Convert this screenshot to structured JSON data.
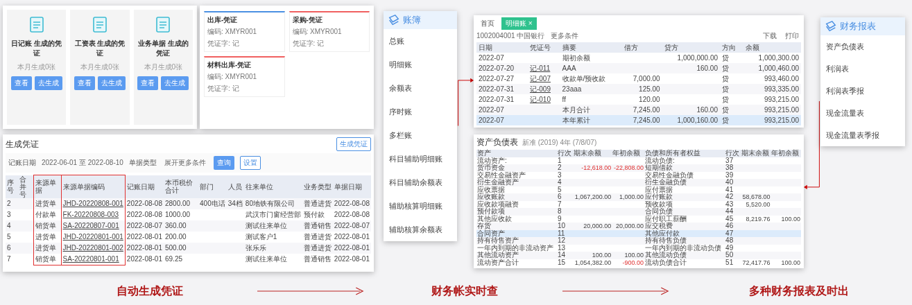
{
  "voucher_gen": {
    "cards": [
      {
        "title": "日记账 生成的凭证",
        "count": "本月生成0张",
        "buttons": [
          "查看",
          "去生成"
        ]
      },
      {
        "title": "工资表 生成的凭证",
        "count": "本月生成0张",
        "buttons": [
          "查看",
          "去生成"
        ]
      },
      {
        "title": "业务单据 生成的凭证",
        "count": "本月生成0张",
        "buttons": [
          "查看",
          "去生成"
        ]
      }
    ],
    "templates": [
      {
        "title": "出库-凭证",
        "code": "编码: XMYR001",
        "word": "凭证字: 记",
        "color": "#4a90e2"
      },
      {
        "title": "采购-凭证",
        "code": "编码: XMYR001",
        "word": "凭证字: 记",
        "color": "#f06060"
      },
      {
        "title": "材料出库-凭证",
        "code": "编码: XMYR001",
        "word": "凭证字: 记",
        "color": "#f06060"
      }
    ],
    "table": {
      "title": "生成凭证",
      "action": "生成凭证",
      "date_label": "记账日期",
      "date_range": "2022-06-01 至 2022-08-10",
      "type_label": "单据类型",
      "query": "查询",
      "settings": "设置",
      "expand": "展开更多条件",
      "columns": [
        {
          "label": "序号",
          "highlighted": false
        },
        {
          "label": "合并号",
          "highlighted": false
        },
        {
          "label": "来源单据",
          "highlighted": true
        },
        {
          "label": "来源单据编码",
          "highlighted": true
        },
        {
          "label": "记账日期",
          "highlighted": false
        },
        {
          "label": "本币税价合计",
          "highlighted": false
        },
        {
          "label": "部门",
          "highlighted": false
        },
        {
          "label": "人员",
          "highlighted": false
        },
        {
          "label": "往来单位",
          "highlighted": false
        },
        {
          "label": "业务类型",
          "highlighted": false
        },
        {
          "label": "单据日期",
          "highlighted": false
        }
      ],
      "rows": [
        [
          "2",
          "",
          "进货单",
          "JHD-20220808-001",
          "2022-08-08",
          "2800.00",
          "400电话",
          "34档",
          "80地铁有限公司",
          "普通进货",
          "2022-08-08"
        ],
        [
          "3",
          "",
          "付款单",
          "FK-20220808-003",
          "2022-08-08",
          "1000.00",
          "",
          "",
          "武汉市门窗经营部",
          "预付款",
          "2022-08-08"
        ],
        [
          "4",
          "",
          "销货单",
          "SA-20220807-001",
          "2022-08-07",
          "360.00",
          "",
          "",
          "测试往来单位",
          "普通销售",
          "2022-08-07"
        ],
        [
          "5",
          "",
          "进货单",
          "JHD-20220801-001",
          "2022-08-01",
          "200.00",
          "",
          "",
          "测试客户1",
          "普通进货",
          "2022-08-01"
        ],
        [
          "6",
          "",
          "进货单",
          "JHD-20220801-002",
          "2022-08-01",
          "500.00",
          "",
          "",
          "张乐乐",
          "普通进货",
          "2022-08-01"
        ],
        [
          "7",
          "",
          "销货单",
          "SA-20220801-001",
          "2022-08-01",
          "69.25",
          "",
          "",
          "测试往来单位",
          "普通销售",
          "2022-08-01"
        ]
      ]
    }
  },
  "ledger_menu": {
    "title": "账簿",
    "items": [
      "总账",
      "明细账",
      "余额表",
      "序时账",
      "多栏账",
      "科目辅助明细账",
      "科目辅助余额表",
      "辅助核算明细账",
      "辅助核算余额表"
    ]
  },
  "ledger": {
    "tabs": [
      {
        "label": "首页",
        "selected": false
      },
      {
        "label": "明细账 ×",
        "selected": true
      }
    ],
    "account": "1002004001 中国银行",
    "more": "更多条件",
    "download": "下载",
    "print": "打印",
    "columns": [
      "日期",
      "凭证号",
      "摘要",
      "借方",
      "贷方",
      "方向",
      "余额"
    ],
    "rows": [
      {
        "cells": [
          "2022-07",
          "",
          "期初余额",
          "",
          "1,000,000.00",
          "贷",
          "1,000,300.00"
        ],
        "selected": false
      },
      {
        "cells": [
          "2022-07-20",
          "记-011",
          "AAA",
          "",
          "160.00",
          "贷",
          "1,000,460.00"
        ],
        "selected": false
      },
      {
        "cells": [
          "2022-07-27",
          "记-007",
          "收款单/预收款",
          "7,000.00",
          "",
          "贷",
          "993,460.00"
        ],
        "selected": false
      },
      {
        "cells": [
          "2022-07-31",
          "记-009",
          "23aaa",
          "125.00",
          "",
          "贷",
          "993,335.00"
        ],
        "selected": false
      },
      {
        "cells": [
          "2022-07-31",
          "记-010",
          "ff",
          "120.00",
          "",
          "贷",
          "993,215.00"
        ],
        "selected": false
      },
      {
        "cells": [
          "2022-07",
          "",
          "本月合计",
          "7,245.00",
          "160.00",
          "贷",
          "993,215.00"
        ],
        "selected": false
      },
      {
        "cells": [
          "2022-07",
          "",
          "本年累计",
          "7,245.00",
          "1,000,160.00",
          "贷",
          "993,215.00"
        ],
        "selected": true
      }
    ]
  },
  "balance_sheet": {
    "title": "资产负债表",
    "period": "新准 (2019) 4年 (7/8/07)",
    "columns": [
      "资产",
      "行次",
      "期末余额",
      "年初余额",
      "负债和所有者权益",
      "行次",
      "期末余额",
      "年初余额"
    ],
    "rows": [
      {
        "cells": [
          "流动资产:",
          "1",
          "",
          "",
          "流动负债:",
          "37",
          "",
          ""
        ],
        "selected": false
      },
      {
        "cells": [
          "货币资金",
          "2",
          "-12,618.00",
          "-22,808.00",
          "短期借款",
          "38",
          "",
          ""
        ],
        "selected": false
      },
      {
        "cells": [
          "交易性金融资产",
          "3",
          "",
          "",
          "交易性金融负债",
          "39",
          "",
          ""
        ],
        "selected": false
      },
      {
        "cells": [
          "衍生金融资产",
          "4",
          "",
          "",
          "衍生金融负债",
          "40",
          "",
          ""
        ],
        "selected": false
      },
      {
        "cells": [
          "应收票据",
          "5",
          "",
          "",
          "应付票据",
          "41",
          "",
          ""
        ],
        "selected": false
      },
      {
        "cells": [
          "应收账款",
          "6",
          "1,067,200.00",
          "1,000.00",
          "应付账款",
          "42",
          "58,678.00",
          ""
        ],
        "selected": false
      },
      {
        "cells": [
          "应收款项融资",
          "7",
          "",
          "",
          "预收款项",
          "43",
          "5,520.00",
          ""
        ],
        "selected": false
      },
      {
        "cells": [
          "预付款项",
          "8",
          "",
          "",
          "合同负债",
          "44",
          "",
          ""
        ],
        "selected": false
      },
      {
        "cells": [
          "其他应收款",
          "9",
          "",
          "",
          "应付职工薪酬",
          "45",
          "8,219.76",
          "100.00"
        ],
        "selected": false
      },
      {
        "cells": [
          "存货",
          "10",
          "20,000.00",
          "20,000.00",
          "应交税费",
          "46",
          "",
          ""
        ],
        "selected": false
      },
      {
        "cells": [
          "合同资产",
          "11",
          "",
          "",
          "其他应付款",
          "47",
          "",
          ""
        ],
        "selected": true
      },
      {
        "cells": [
          "持有待售资产",
          "12",
          "",
          "",
          "持有待售负债",
          "48",
          "",
          ""
        ],
        "selected": false
      },
      {
        "cells": [
          "一年内到期的非流动资产",
          "13",
          "",
          "",
          "一年内到期的非流动负债",
          "49",
          "",
          ""
        ],
        "selected": false
      },
      {
        "cells": [
          "其他流动资产",
          "14",
          "100.00",
          "100.00",
          "其他流动负债",
          "50",
          "",
          ""
        ],
        "selected": false
      },
      {
        "cells": [
          "流动资产合计",
          "15",
          "1,054,382.00",
          "-900.00",
          "流动负债合计",
          "51",
          "72,417.76",
          "100.00"
        ],
        "selected": false
      }
    ]
  },
  "report_menu": {
    "title": "财务报表",
    "items": [
      "资产负债表",
      "利润表",
      "利润表季报",
      "现金流量表",
      "现金流量表季报"
    ]
  },
  "captions": [
    "自动生成凭证",
    "财务帐实时查",
    "多种财务报表及时出"
  ]
}
